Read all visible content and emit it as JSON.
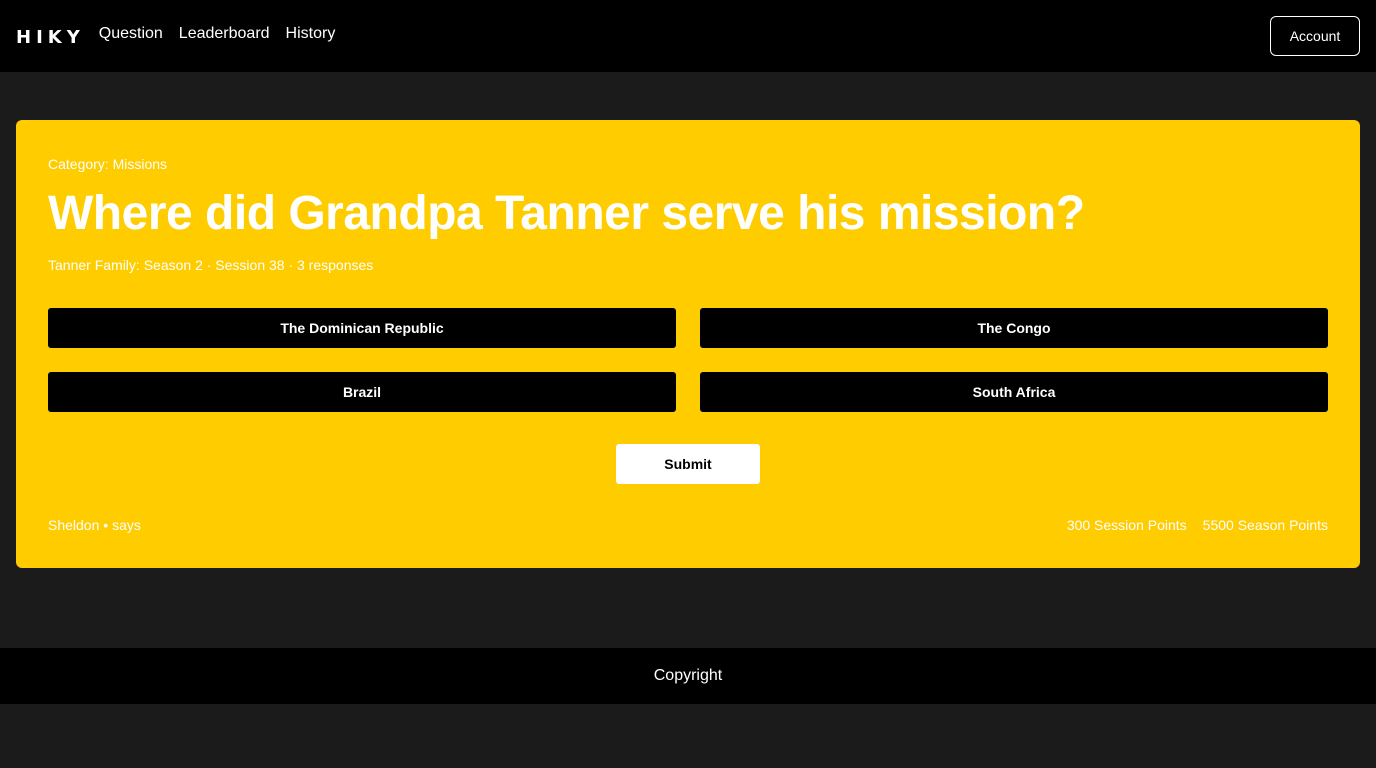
{
  "header": {
    "logo": "HIKY",
    "nav": [
      "Question",
      "Leaderboard",
      "History"
    ],
    "account_label": "Account"
  },
  "card": {
    "category_label": "Category:",
    "category_value": "Missions",
    "question": "Where did Grandpa Tanner serve his mission?",
    "meta": "Tanner Family: Season 2 · Session 38 · 3 responses",
    "answers": [
      "The Dominican Republic",
      "The Congo",
      "Brazil",
      "South Africa"
    ],
    "submit_label": "Submit",
    "speaker": "Sheldon",
    "speaker_separator": "•",
    "speaker_verb": "says",
    "session_points": "300 Session Points",
    "season_points": "5500 Season Points"
  },
  "footer": {
    "text": "Copyright"
  },
  "colors": {
    "topbar": "#000000",
    "page_bg": "#1b1b1b",
    "card_bg": "#ffcc00",
    "answer_bg": "#000000",
    "submit_bg": "#ffffff"
  }
}
